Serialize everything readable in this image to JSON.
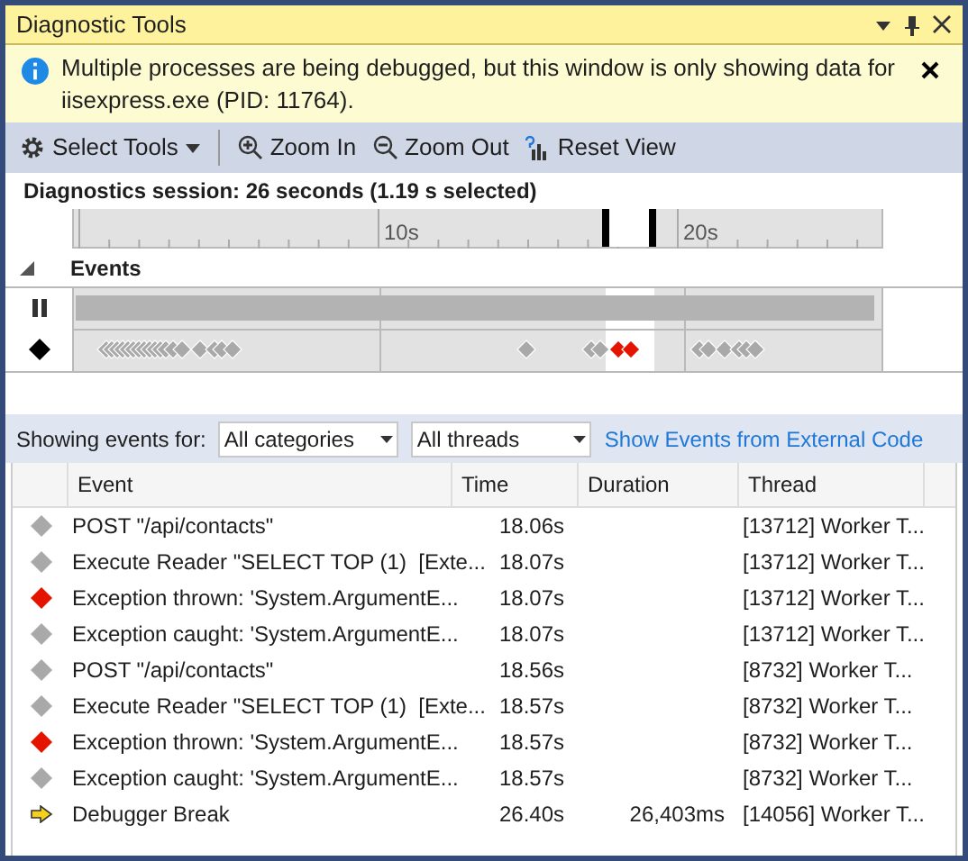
{
  "window": {
    "title": "Diagnostic Tools"
  },
  "info_bar": {
    "message": "Multiple processes are being debugged, but this window is only showing data for iisexpress.exe (PID: 11764)."
  },
  "toolbar": {
    "items": [
      {
        "kind": "select",
        "label": "Select Tools"
      },
      {
        "kind": "zoom_in",
        "label": "Zoom In"
      },
      {
        "kind": "zoom_out",
        "label": "Zoom Out"
      },
      {
        "kind": "reset",
        "label": "Reset View"
      }
    ]
  },
  "session": {
    "summary": "Diagnostics session: 26 seconds (1.19 s selected)"
  },
  "ruler": {
    "labels": [
      "10s",
      "20s"
    ]
  },
  "events_section": {
    "title": "Events",
    "expanded": true
  },
  "filter": {
    "label": "Showing events for:",
    "category": "All categories",
    "thread": "All threads",
    "link": "Show Events from External Code"
  },
  "table": {
    "columns": [
      "Event",
      "Time",
      "Duration",
      "Thread"
    ],
    "rows": [
      {
        "kind": "event",
        "event": "POST \"/api/contacts\"",
        "time": "18.06s",
        "thread": "[13712] Worker T..."
      },
      {
        "kind": "event",
        "event": "Execute Reader \"SELECT TOP (1)  [Exte...",
        "time": "18.07s",
        "thread": "[13712] Worker T..."
      },
      {
        "kind": "exception",
        "event": "Exception thrown: 'System.ArgumentE...",
        "time": "18.07s",
        "thread": "[13712] Worker T..."
      },
      {
        "kind": "event",
        "event": "Exception caught: 'System.ArgumentE...",
        "time": "18.07s",
        "thread": "[13712] Worker T..."
      },
      {
        "kind": "event",
        "event": "POST \"/api/contacts\"",
        "time": "18.56s",
        "thread": "[8732] Worker T..."
      },
      {
        "kind": "event",
        "event": "Execute Reader \"SELECT TOP (1)  [Exte...",
        "time": "18.57s",
        "thread": "[8732] Worker T..."
      },
      {
        "kind": "exception",
        "event": "Exception thrown: 'System.ArgumentE...",
        "time": "18.57s",
        "thread": "[8732] Worker T..."
      },
      {
        "kind": "event",
        "event": "Exception caught: 'System.ArgumentE...",
        "time": "18.57s",
        "thread": "[8732] Worker T..."
      },
      {
        "kind": "break",
        "event": "Debugger Break",
        "time": "26.40s",
        "duration": "26,403ms",
        "thread": "[14056] Worker T..."
      }
    ]
  }
}
